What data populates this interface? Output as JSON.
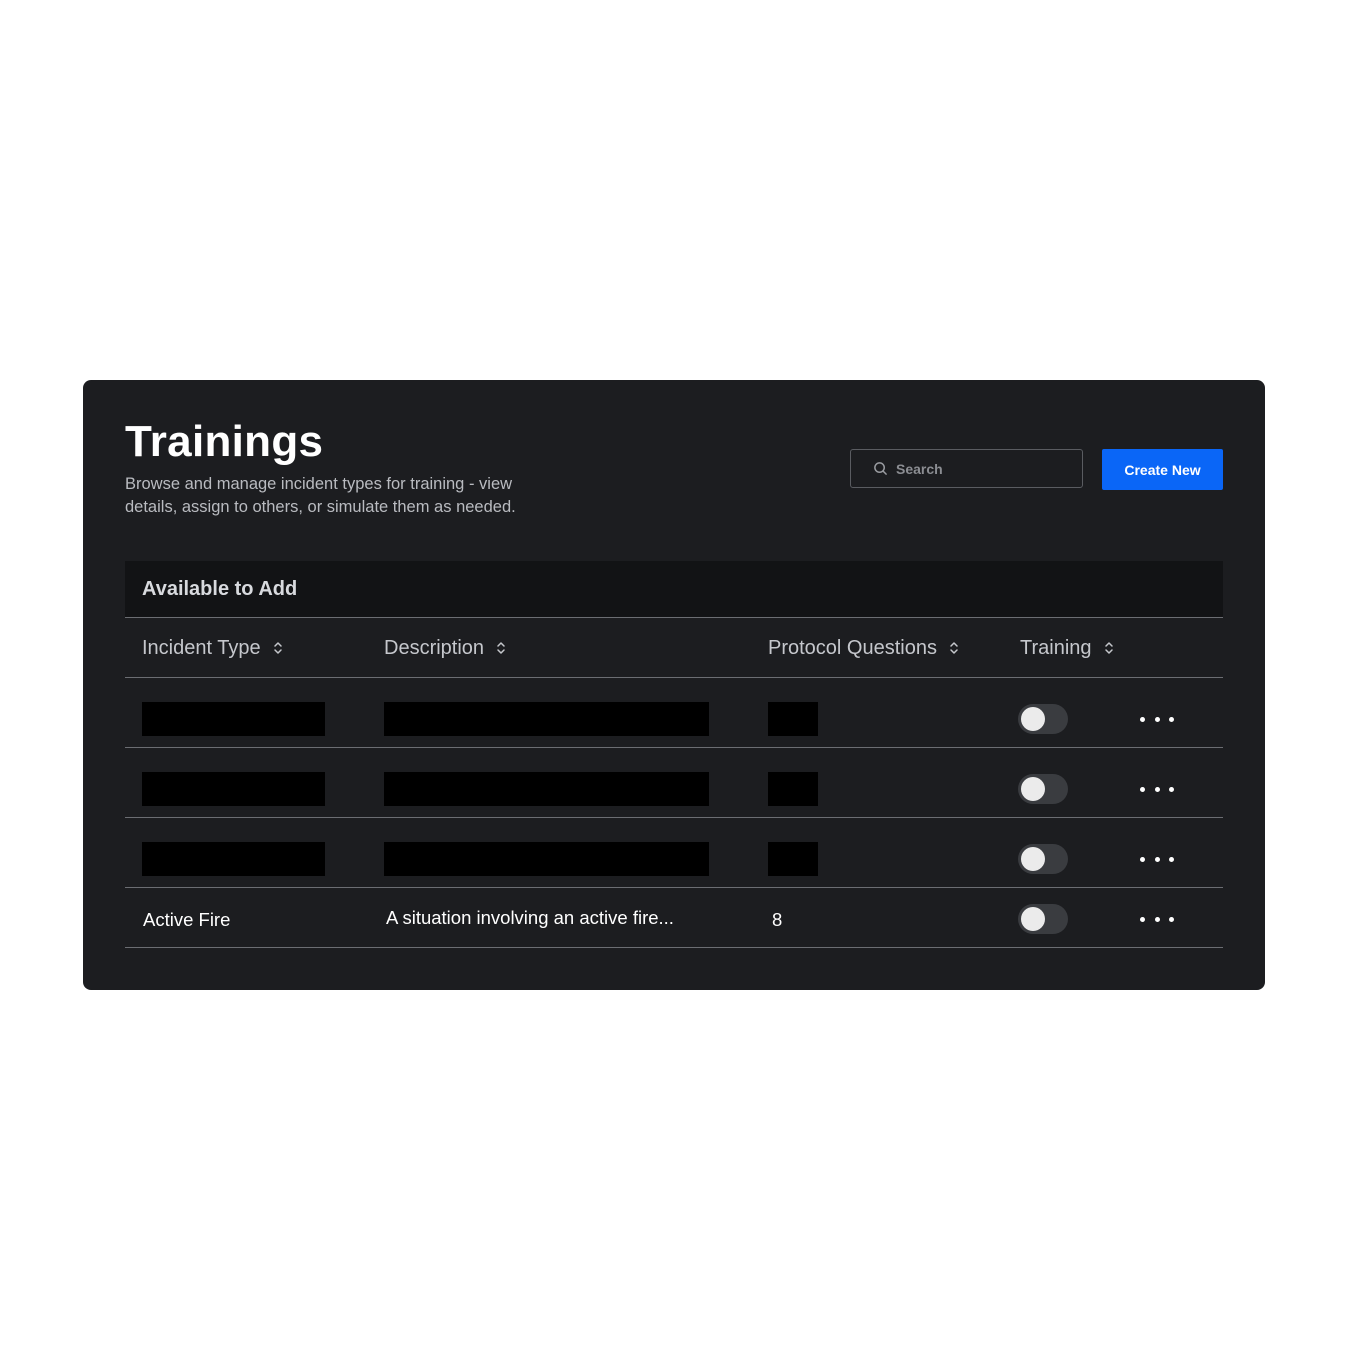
{
  "header": {
    "title": "Trainings",
    "subtitle": "Browse and manage incident types for training - view details, assign to others, or simulate them as needed."
  },
  "search": {
    "placeholder": "Search",
    "value": "",
    "icon": "search-icon"
  },
  "actions": {
    "create_label": "Create New"
  },
  "colors": {
    "panel_bg": "#1c1d20",
    "accent": "#0a66f7",
    "section_bg": "#121315"
  },
  "section": {
    "title": "Available to Add"
  },
  "table": {
    "columns": [
      {
        "label": "Incident Type",
        "sort_icon": "sort-icon"
      },
      {
        "label": "Description",
        "sort_icon": "sort-icon"
      },
      {
        "label": "Protocol Questions",
        "sort_icon": "sort-icon"
      },
      {
        "label": "Training",
        "sort_icon": "sort-icon"
      }
    ],
    "rows": [
      {
        "redacted": true,
        "incident_type": "",
        "description": "",
        "protocol_questions": "",
        "training_enabled": false
      },
      {
        "redacted": true,
        "incident_type": "",
        "description": "",
        "protocol_questions": "",
        "training_enabled": false
      },
      {
        "redacted": true,
        "incident_type": "",
        "description": "",
        "protocol_questions": "",
        "training_enabled": false
      },
      {
        "redacted": false,
        "incident_type": "Active Fire",
        "description": "A situation involving an active fire...",
        "protocol_questions": "8",
        "training_enabled": false
      }
    ]
  }
}
